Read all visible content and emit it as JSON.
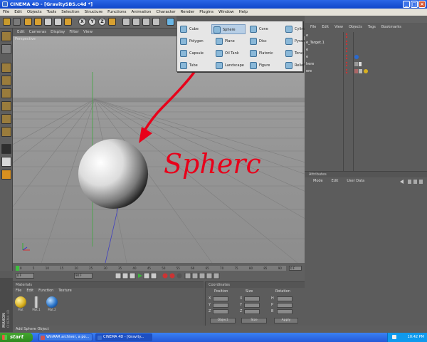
{
  "window": {
    "title": "CINEMA 4D - [GravitySBS.c4d *]",
    "buttons": {
      "minimize": "_",
      "maximize": "□",
      "close": "×"
    }
  },
  "menubar": [
    "File",
    "Edit",
    "Objects",
    "Tools",
    "Selection",
    "Structure",
    "Functions",
    "Animation",
    "Character",
    "Render",
    "Plugins",
    "Window",
    "Help"
  ],
  "toolbar": {
    "axis_x": "X",
    "axis_y": "Y",
    "axis_z": "Z"
  },
  "viewport": {
    "menu": [
      "Edit",
      "Cameras",
      "Display",
      "Filter",
      "View"
    ],
    "label": "Perspective",
    "annotation": "Spherc"
  },
  "primitives_menu": {
    "items": [
      {
        "label": "Cube",
        "selected": false
      },
      {
        "label": "Sphere",
        "selected": true
      },
      {
        "label": "Cone",
        "selected": false
      },
      {
        "label": "Cylinder",
        "selected": false
      },
      {
        "label": "Polygon",
        "selected": false
      },
      {
        "label": "Plane",
        "selected": false
      },
      {
        "label": "Disc",
        "selected": false
      },
      {
        "label": "Pyramid",
        "selected": false
      },
      {
        "label": "Capsule",
        "selected": false
      },
      {
        "label": "Oil Tank",
        "selected": false
      },
      {
        "label": "Platonic",
        "selected": false
      },
      {
        "label": "Torus",
        "selected": false
      },
      {
        "label": "Tube",
        "selected": false
      },
      {
        "label": "Landscape",
        "selected": false
      },
      {
        "label": "Figure",
        "selected": false
      },
      {
        "label": "Relief",
        "selected": false
      }
    ]
  },
  "object_manager": {
    "menu": [
      "File",
      "Edit",
      "View",
      "Objects",
      "Tags",
      "Bookmarks"
    ],
    "rows": [
      "e",
      "e_Target.1",
      "e",
      "e",
      "here",
      "ere"
    ]
  },
  "attributes": {
    "title": "Attributes",
    "menu": [
      "Mode",
      "Edit",
      "User Data"
    ]
  },
  "timeline": {
    "ticks": [
      "0",
      "5",
      "10",
      "15",
      "20",
      "25",
      "30",
      "35",
      "40",
      "45",
      "50",
      "55",
      "60",
      "65",
      "70",
      "75",
      "80",
      "85",
      "90"
    ],
    "start_field": "0 F",
    "end_field": "90 F",
    "current_field": "0 F"
  },
  "materials": {
    "title": "Materials",
    "menu": [
      "File",
      "Edit",
      "Function",
      "Texture"
    ],
    "items": [
      {
        "name": "Mat",
        "color": "#d8b020"
      },
      {
        "name": "Mat.1",
        "color": "#c0c0c0"
      },
      {
        "name": "Mat.2",
        "color": "#2a74c8"
      }
    ]
  },
  "coordinates": {
    "title": "Coordinates",
    "col_headers": [
      "Position",
      "Size",
      "Rotation"
    ],
    "row_position": [
      "X",
      "Y",
      "Z"
    ],
    "row_size": [
      "X",
      "Y",
      "Z"
    ],
    "row_rotation": [
      "H",
      "P",
      "B"
    ],
    "mode_object": "Object",
    "mode_size": "Size",
    "apply": "Apply"
  },
  "status": {
    "text": "Add Sphere Object"
  },
  "branding": [
    "MAXON",
    "CINEMA 4D"
  ],
  "taskbar": {
    "start": "start",
    "tasks": [
      {
        "label": "WinRAR archiver, a po...",
        "active": false
      },
      {
        "label": "CINEMA 4D - [Gravity...",
        "active": true
      }
    ],
    "clock": "10:42 PM"
  }
}
